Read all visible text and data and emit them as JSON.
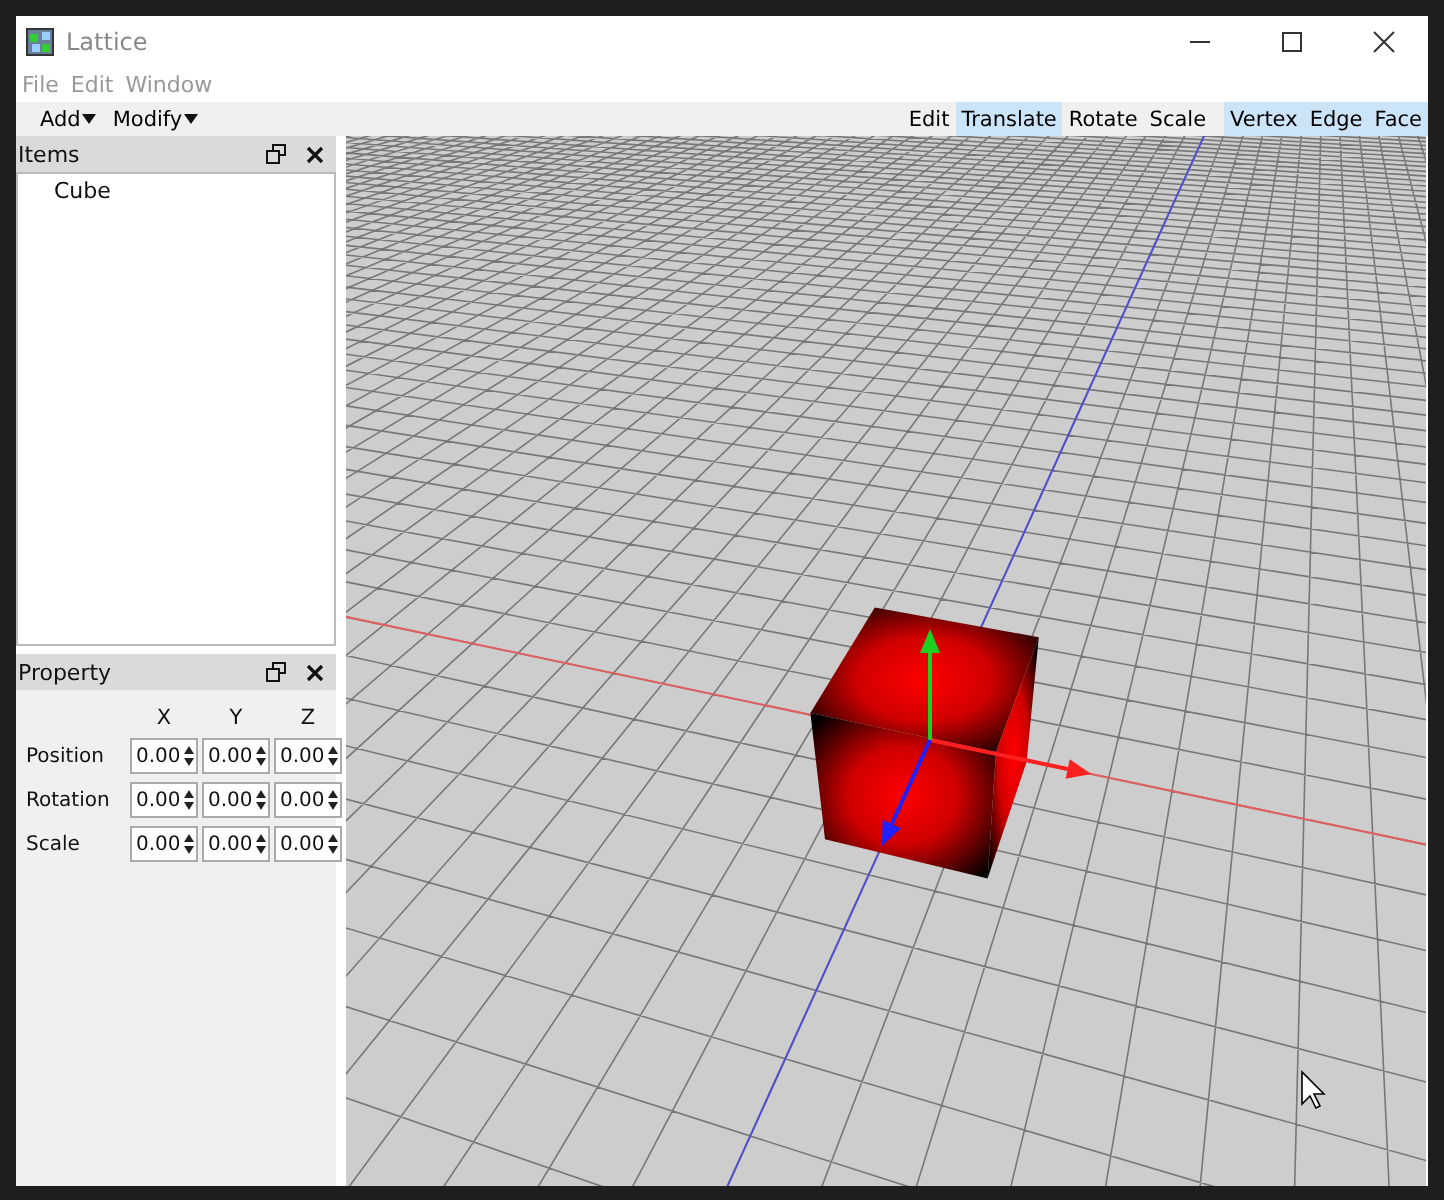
{
  "window": {
    "title": "Lattice"
  },
  "menu": [
    {
      "label": "File",
      "disabled": true
    },
    {
      "label": "Edit",
      "disabled": true
    },
    {
      "label": "Window",
      "disabled": true
    }
  ],
  "toolbar": {
    "left": [
      {
        "label": "Add"
      },
      {
        "label": "Modify"
      }
    ],
    "groups": [
      [
        {
          "label": "Edit",
          "selected": false
        },
        {
          "label": "Translate",
          "selected": true
        },
        {
          "label": "Rotate",
          "selected": false
        },
        {
          "label": "Scale",
          "selected": false
        }
      ],
      [
        {
          "label": "Vertex",
          "selected": true
        },
        {
          "label": "Edge",
          "selected": true
        },
        {
          "label": "Face",
          "selected": true
        }
      ]
    ]
  },
  "items_panel": {
    "title": "Items",
    "items": [
      {
        "label": "Cube",
        "selected": false
      }
    ]
  },
  "property_panel": {
    "title": "Property",
    "columns": [
      "X",
      "Y",
      "Z"
    ],
    "rows": [
      {
        "label": "Position",
        "values": [
          "0.00",
          "0.00",
          "0.00"
        ]
      },
      {
        "label": "Rotation",
        "values": [
          "0.00",
          "0.00",
          "0.00"
        ]
      },
      {
        "label": "Scale",
        "values": [
          "0.00",
          "0.00",
          "0.00"
        ]
      }
    ]
  }
}
